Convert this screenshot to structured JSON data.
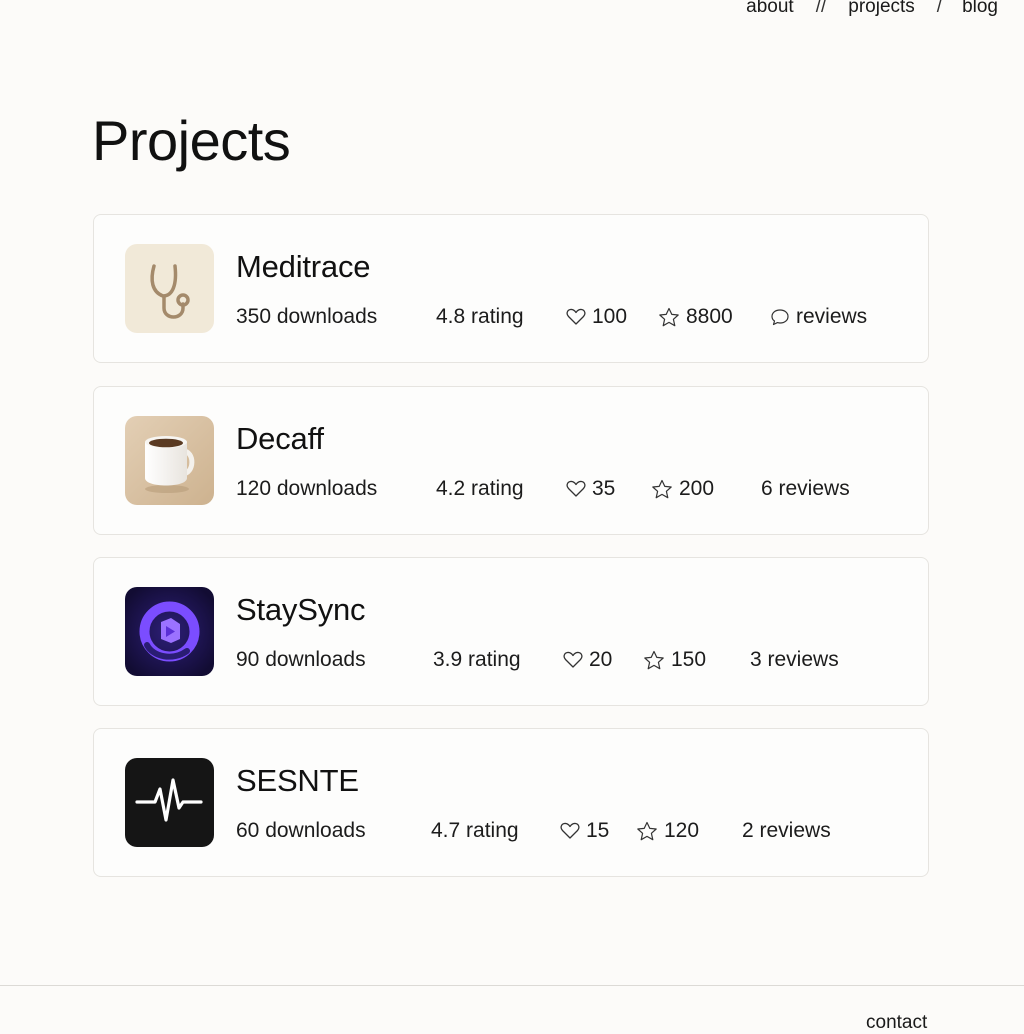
{
  "nav": {
    "links": [
      "about",
      "projects",
      "blog"
    ],
    "separators": [
      "//",
      "/"
    ]
  },
  "page": {
    "title": "Projects"
  },
  "projects": [
    {
      "name": "Meditrace",
      "icon": "stethoscope-icon",
      "downloads": "350 downloads",
      "rating": "4.8 rating",
      "likes": "100",
      "stars": "8800",
      "reviews": "reviews",
      "reviews_icon": "comment-icon"
    },
    {
      "name": "Decaff",
      "icon": "coffee-mug-icon",
      "downloads": "120 downloads",
      "rating": "4.2 rating",
      "likes": "35",
      "stars": "200",
      "reviews": "6 reviews"
    },
    {
      "name": "StaySync",
      "icon": "staysync-logo-icon",
      "downloads": "90 downloads",
      "rating": "3.9 rating",
      "likes": "20",
      "stars": "150",
      "reviews": "3 reviews"
    },
    {
      "name": "SESNTE",
      "icon": "heartbeat-icon",
      "downloads": "60 downloads",
      "rating": "4.7 rating",
      "likes": "15",
      "stars": "120",
      "reviews": "2 reviews"
    }
  ],
  "footer": {
    "link": "contact"
  },
  "colors": {
    "background": "#fcfbf9",
    "card_border": "#e6e4e0",
    "meditrace_icon_bg": "#f1e9d8",
    "decaff_icon_bg": "#d9c2a6",
    "staysync_icon_bg": "#1a1445",
    "staysync_accent": "#7b4dff",
    "sesnte_icon_bg": "#151515"
  }
}
